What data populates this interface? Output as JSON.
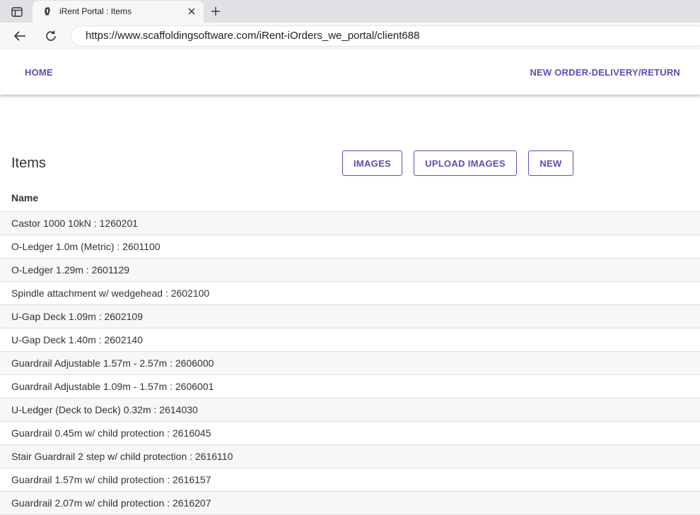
{
  "browser": {
    "tab_title": "iRent Portal : Items",
    "url": "https://www.scaffoldingsoftware.com/iRent-iOrders_we_portal/client688"
  },
  "nav": {
    "home": "HOME",
    "new_order": "NEW ORDER-DELIVERY/RETURN"
  },
  "page": {
    "title": "Items",
    "buttons": {
      "images": "IMAGES",
      "upload_images": "UPLOAD IMAGES",
      "new": "NEW"
    }
  },
  "table": {
    "column_header": "Name",
    "rows": [
      "Castor 1000 10kN : 1260201",
      "O-Ledger 1.0m (Metric) : 2601100",
      "O-Ledger 1.29m : 2601129",
      "Spindle attachment w/ wedgehead : 2602100",
      "U-Gap Deck 1.09m : 2602109",
      "U-Gap Deck 1.40m : 2602140",
      "Guardrail Adjustable 1.57m - 2.57m : 2606000",
      "Guardrail Adjustable 1.09m - 1.57m : 2606001",
      "U-Ledger (Deck to Deck) 0.32m : 2614030",
      "Guardrail 0.45m w/ child protection : 2616045",
      "Stair Guardrail 2 step w/ child protection : 2616110",
      "Guardrail 1.57m w/ child protection : 2616157",
      "Guardrail 2.07m w/ child protection : 2616207"
    ]
  },
  "colors": {
    "accent": "#5b4fb3",
    "row_alt": "#f7f7f7",
    "border": "#dddddd"
  },
  "icons": [
    "sidebar-toggle-icon",
    "favicon-icon",
    "close-icon",
    "plus-icon",
    "back-arrow-icon",
    "reload-icon"
  ]
}
